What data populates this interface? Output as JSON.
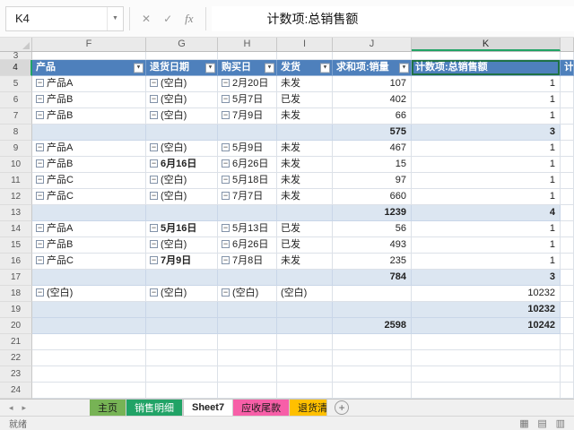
{
  "formula_bar": {
    "name_box": "K4",
    "cancel": "✕",
    "enter": "✓",
    "fx": "fx",
    "formula": "计数项:总销售额"
  },
  "grid": {
    "columns": [
      {
        "letter": "F",
        "width": 127
      },
      {
        "letter": "G",
        "width": 80
      },
      {
        "letter": "H",
        "width": 66
      },
      {
        "letter": "I",
        "width": 62
      },
      {
        "letter": "J",
        "width": 88
      },
      {
        "letter": "K",
        "width": 166,
        "selected": true
      },
      {
        "letter": "",
        "width": 15
      }
    ],
    "header_row": {
      "number": "4",
      "cells": [
        {
          "label": "产品",
          "filter": true
        },
        {
          "label": "退货日期",
          "filter": true
        },
        {
          "label": "购买日",
          "filter": true
        },
        {
          "label": "发货",
          "filter": true
        },
        {
          "label": "求和项:销量",
          "filter": true
        },
        {
          "label": "计数项:总销售额",
          "filter": false,
          "selected": true
        },
        {
          "label": "计数",
          "filter": false
        }
      ]
    },
    "rows": [
      {
        "n": 3,
        "type": "empty",
        "partial": true
      },
      {
        "n": 5,
        "type": "data",
        "f": "产品A",
        "g": "(空白)",
        "h": "2月20日",
        "i": "未发",
        "j": "107",
        "k": "1"
      },
      {
        "n": 6,
        "type": "data",
        "f": "产品B",
        "g": "(空白)",
        "h": "5月7日",
        "i": "已发",
        "j": "402",
        "k": "1"
      },
      {
        "n": 7,
        "type": "data",
        "f": "产品B",
        "g": "(空白)",
        "h": "7月9日",
        "i": "未发",
        "j": "66",
        "k": "1"
      },
      {
        "n": 8,
        "type": "subtotal",
        "j": "575",
        "k": "3"
      },
      {
        "n": 9,
        "type": "data",
        "f": "产品A",
        "g": "(空白)",
        "h": "5月9日",
        "i": "未发",
        "j": "467",
        "k": "1"
      },
      {
        "n": 10,
        "type": "data",
        "f": "产品B",
        "g": "6月16日",
        "gBold": true,
        "h": "6月26日",
        "i": "未发",
        "j": "15",
        "k": "1"
      },
      {
        "n": 11,
        "type": "data",
        "f": "产品C",
        "g": "(空白)",
        "h": "5月18日",
        "i": "未发",
        "j": "97",
        "k": "1"
      },
      {
        "n": 12,
        "type": "data",
        "f": "产品C",
        "g": "(空白)",
        "h": "7月7日",
        "i": "未发",
        "j": "660",
        "k": "1"
      },
      {
        "n": 13,
        "type": "subtotal",
        "j": "1239",
        "k": "4"
      },
      {
        "n": 14,
        "type": "data",
        "f": "产品A",
        "g": "5月16日",
        "gBold": true,
        "h": "5月13日",
        "i": "已发",
        "j": "56",
        "k": "1"
      },
      {
        "n": 15,
        "type": "data",
        "f": "产品B",
        "g": "(空白)",
        "h": "6月26日",
        "i": "已发",
        "j": "493",
        "k": "1"
      },
      {
        "n": 16,
        "type": "data",
        "f": "产品C",
        "g": "7月9日",
        "gBold": true,
        "h": "7月8日",
        "i": "未发",
        "j": "235",
        "k": "1"
      },
      {
        "n": 17,
        "type": "subtotal",
        "j": "784",
        "k": "3"
      },
      {
        "n": 18,
        "type": "data",
        "f": "(空白)",
        "g": "(空白)",
        "h": "(空白)",
        "i": "(空白)",
        "j": "",
        "k": "10232"
      },
      {
        "n": 19,
        "type": "subtotal",
        "j": "",
        "k": "10232"
      },
      {
        "n": 20,
        "type": "total",
        "j": "2598",
        "k": "10242"
      },
      {
        "n": 21,
        "type": "empty"
      },
      {
        "n": 22,
        "type": "empty"
      },
      {
        "n": 23,
        "type": "empty"
      },
      {
        "n": 24,
        "type": "empty"
      }
    ]
  },
  "sheet_tabs": {
    "add_label": "+",
    "tabs": [
      {
        "label": "主页",
        "color": "#77B355",
        "text": "#1a1a1a"
      },
      {
        "label": "销售明细",
        "color": "#21A366",
        "text": "#ffffff"
      },
      {
        "label": "Sheet7",
        "active": true
      },
      {
        "label": "应收尾款",
        "color": "#F75FA8",
        "text": "#1a1a1a"
      },
      {
        "label": "退货清单",
        "color": "#FFC000",
        "text": "#1a1a1a",
        "clipped": true
      }
    ]
  },
  "status_bar": {
    "left": "就绪"
  }
}
